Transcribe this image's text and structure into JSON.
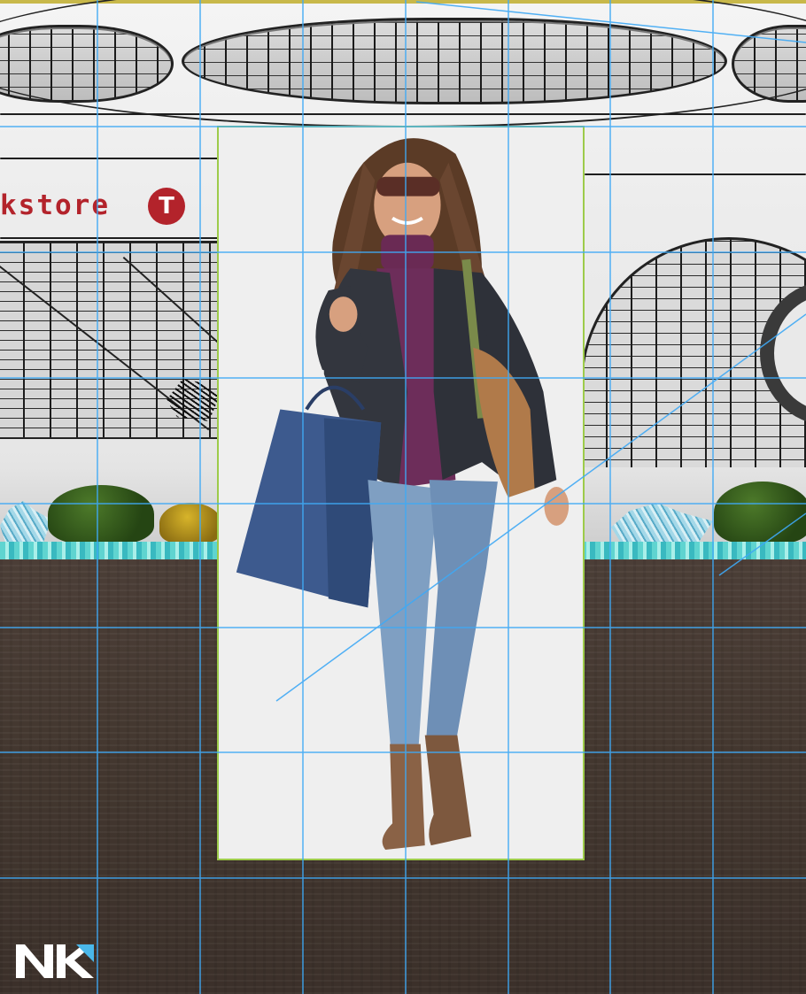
{
  "scene": {
    "store_sign_text": "kstore",
    "store_logo_glyph": "T",
    "sign_color": "#b3232b",
    "guide_color": "#3fa9f5",
    "panel_border_color": "#9dcb4a",
    "ground_color": "#43372f"
  },
  "cutout": {
    "subject": "woman-with-shopping-bag",
    "background_color": "#efefef"
  },
  "watermark": {
    "logo": "NK-logo"
  }
}
